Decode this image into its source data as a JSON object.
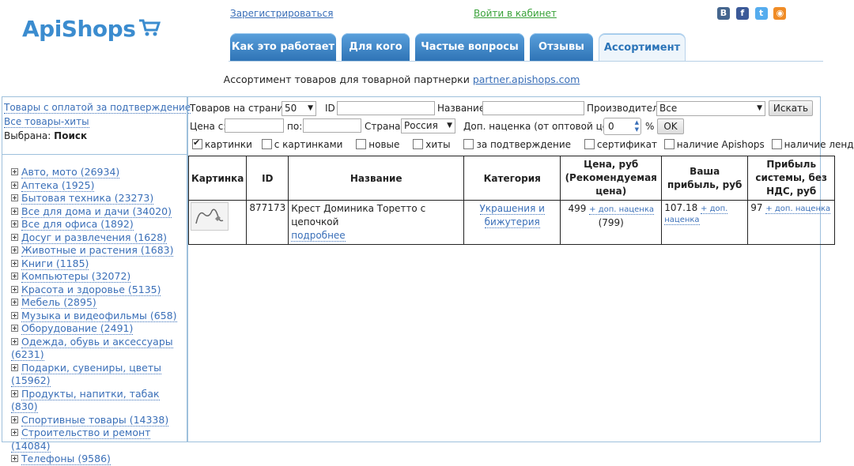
{
  "header": {
    "logo": "ApiShops",
    "register_link": "Зарегистрироваться",
    "login_link": "Войти в кабинет",
    "social": [
      "В",
      "f",
      "t",
      "rss"
    ]
  },
  "tabs": [
    {
      "label": "Как это работает",
      "active": false
    },
    {
      "label": "Для кого",
      "active": false
    },
    {
      "label": "Частые вопросы",
      "active": false
    },
    {
      "label": "Отзывы",
      "active": false
    },
    {
      "label": "Ассортимент",
      "active": true
    }
  ],
  "subtitle": {
    "text": "Ассортимент товаров для товарной партнерки",
    "link": "partner.apishops.com"
  },
  "sidebar": {
    "link1": "Товары с оплатой за подтверждение",
    "link2": "Все товары-хиты",
    "selected_label": "Выбрана:",
    "selected_value": "Поиск",
    "categories": [
      "Авто, мото (26934)",
      "Аптека (1925)",
      "Бытовая техника (23273)",
      "Все для дома и дачи (34020)",
      "Все для офиса (1892)",
      "Досуг и развлечения (1628)",
      "Животные и растения (1683)",
      "Книги (1185)",
      "Компьютеры (32072)",
      "Красота и здоровье (5135)",
      "Мебель (2895)",
      "Музыка и видеофильмы (658)",
      "Оборудование (2491)",
      "Одежда, обувь и аксессуары (6231)",
      "Подарки, сувениры, цветы (15962)",
      "Продукты, напитки, табак (830)",
      "Спортивные товары (14338)",
      "Строительство и ремонт (14084)",
      "Телефоны (9586)"
    ]
  },
  "filters": {
    "per_page_label": "Товаров на страницу",
    "per_page_value": "50",
    "id_label": "ID",
    "id_value": "",
    "name_label": "Название",
    "name_value": "",
    "maker_label": "Производитель",
    "maker_value": "Все",
    "search_button": "Искать",
    "price_from_label": "Цена с:",
    "price_from_value": "",
    "price_to_label": "по:",
    "price_to_value": "",
    "country_label": "Страна:",
    "country_value": "Россия",
    "markup_label": "Доп. наценка (от оптовой цены)",
    "markup_value": "0",
    "markup_unit": "%",
    "ok_button": "OK",
    "checkboxes": [
      {
        "label": "картинки",
        "checked": true
      },
      {
        "label": "с картинками",
        "checked": false
      },
      {
        "label": "новые",
        "checked": false
      },
      {
        "label": "хиты",
        "checked": false
      },
      {
        "label": "за подтверждение",
        "checked": false
      },
      {
        "label": "сертификат",
        "checked": false
      },
      {
        "label": "наличие Apishops",
        "checked": false
      },
      {
        "label": "наличие лендинга",
        "checked": false
      }
    ]
  },
  "table": {
    "headers": {
      "picture": "Картинка",
      "id": "ID",
      "name": "Название",
      "category": "Категория",
      "price": "Цена, руб (Рекомендуемая цена)",
      "profit": "Ваша прибыль, руб",
      "system": "Прибыль системы, без НДС, руб"
    },
    "rows": [
      {
        "id": "877173",
        "name": "Крест Доминика Торетто с цепочкой",
        "more": "подробнее",
        "category": "Украшения и бижутерия",
        "price": "499",
        "price_link": "+ доп. наценка",
        "rec_price": "(799)",
        "profit": "107.18",
        "profit_link": "+ доп. наценка",
        "system": "97",
        "system_link": "+ доп. наценка"
      }
    ]
  },
  "colors": {
    "accent": "#3b8ccf",
    "link": "#3a6fb8",
    "login": "#3aa23a",
    "tab": "#2f74b6"
  }
}
